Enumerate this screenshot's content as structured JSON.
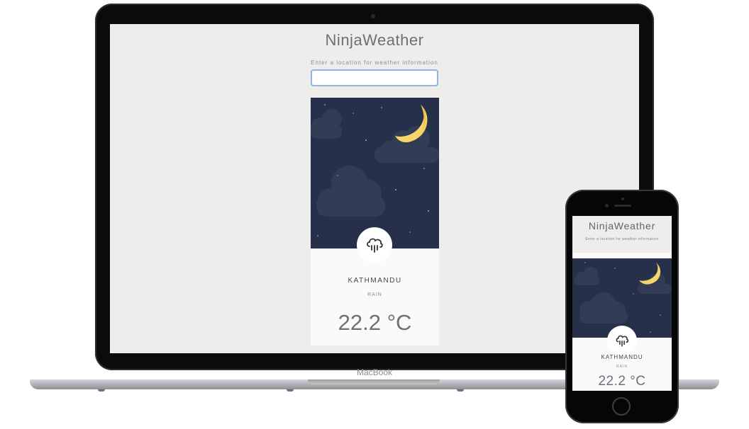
{
  "laptop": {
    "brand_label": "MacBook",
    "app": {
      "title": "NinjaWeather",
      "prompt": "Enter a location for weather information",
      "search_value": "",
      "city": "KATHMANDU",
      "condition": "RAIN",
      "temperature": "22.2 °C",
      "weather_icon": "rain-cloud-icon",
      "scene_icon": "crescent-moon-icon"
    }
  },
  "phone": {
    "app": {
      "title": "NinjaWeather",
      "prompt": "Enter a location for weather information",
      "city": "KATHMANDU",
      "condition": "RAIN",
      "temperature": "22.2 °C",
      "weather_icon": "rain-cloud-icon",
      "scene_icon": "crescent-moon-icon"
    }
  },
  "colors": {
    "night_sky": "#26304a",
    "moon": "#f7d56b",
    "app_background": "#eeedeb",
    "input_focus_border": "#8fb5e6"
  }
}
